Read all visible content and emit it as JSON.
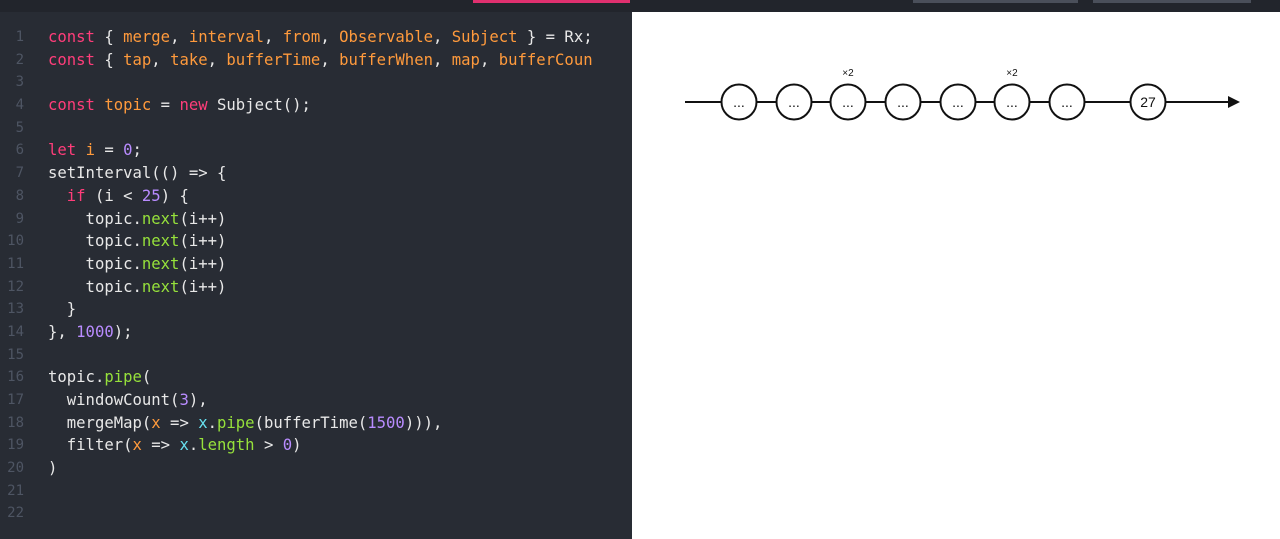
{
  "editor": {
    "line_numbers": [
      "1",
      "2",
      "3",
      "4",
      "5",
      "6",
      "7",
      "8",
      "9",
      "10",
      "11",
      "12",
      "13",
      "14",
      "15",
      "16",
      "17",
      "18",
      "19",
      "20",
      "21",
      "22"
    ],
    "lines": [
      [
        {
          "t": "const",
          "c": "kw"
        },
        {
          "t": " { ",
          "c": ""
        },
        {
          "t": "merge",
          "c": "id"
        },
        {
          "t": ", ",
          "c": ""
        },
        {
          "t": "interval",
          "c": "id"
        },
        {
          "t": ", ",
          "c": ""
        },
        {
          "t": "from",
          "c": "id"
        },
        {
          "t": ", ",
          "c": ""
        },
        {
          "t": "Observable",
          "c": "id"
        },
        {
          "t": ", ",
          "c": ""
        },
        {
          "t": "Subject",
          "c": "id"
        },
        {
          "t": " } = Rx;",
          "c": ""
        }
      ],
      [
        {
          "t": "const",
          "c": "kw"
        },
        {
          "t": " { ",
          "c": ""
        },
        {
          "t": "tap",
          "c": "id"
        },
        {
          "t": ", ",
          "c": ""
        },
        {
          "t": "take",
          "c": "id"
        },
        {
          "t": ", ",
          "c": ""
        },
        {
          "t": "bufferTime",
          "c": "id"
        },
        {
          "t": ", ",
          "c": ""
        },
        {
          "t": "bufferWhen",
          "c": "id"
        },
        {
          "t": ", ",
          "c": ""
        },
        {
          "t": "map",
          "c": "id"
        },
        {
          "t": ", ",
          "c": ""
        },
        {
          "t": "bufferCoun",
          "c": "id"
        }
      ],
      [],
      [
        {
          "t": "const",
          "c": "kw"
        },
        {
          "t": " ",
          "c": ""
        },
        {
          "t": "topic",
          "c": "id"
        },
        {
          "t": " = ",
          "c": ""
        },
        {
          "t": "new",
          "c": "kw"
        },
        {
          "t": " Subject();",
          "c": ""
        }
      ],
      [],
      [
        {
          "t": "let",
          "c": "kw"
        },
        {
          "t": " ",
          "c": ""
        },
        {
          "t": "i",
          "c": "id"
        },
        {
          "t": " = ",
          "c": ""
        },
        {
          "t": "0",
          "c": "num"
        },
        {
          "t": ";",
          "c": ""
        }
      ],
      [
        {
          "t": "setInterval(() => {",
          "c": ""
        }
      ],
      [
        {
          "t": "  ",
          "c": ""
        },
        {
          "t": "if",
          "c": "kw"
        },
        {
          "t": " (i < ",
          "c": ""
        },
        {
          "t": "25",
          "c": "num"
        },
        {
          "t": ") {",
          "c": ""
        }
      ],
      [
        {
          "t": "    topic.",
          "c": ""
        },
        {
          "t": "next",
          "c": "mth"
        },
        {
          "t": "(i++)",
          "c": ""
        }
      ],
      [
        {
          "t": "    topic.",
          "c": ""
        },
        {
          "t": "next",
          "c": "mth"
        },
        {
          "t": "(i++)",
          "c": ""
        }
      ],
      [
        {
          "t": "    topic.",
          "c": ""
        },
        {
          "t": "next",
          "c": "mth"
        },
        {
          "t": "(i++)",
          "c": ""
        }
      ],
      [
        {
          "t": "    topic.",
          "c": ""
        },
        {
          "t": "next",
          "c": "mth"
        },
        {
          "t": "(i++)",
          "c": ""
        }
      ],
      [
        {
          "t": "  }",
          "c": ""
        }
      ],
      [
        {
          "t": "}, ",
          "c": ""
        },
        {
          "t": "1000",
          "c": "num"
        },
        {
          "t": ");",
          "c": ""
        }
      ],
      [],
      [
        {
          "t": "topic.",
          "c": ""
        },
        {
          "t": "pipe",
          "c": "mth"
        },
        {
          "t": "(",
          "c": ""
        }
      ],
      [
        {
          "t": "  windowCount(",
          "c": ""
        },
        {
          "t": "3",
          "c": "num"
        },
        {
          "t": "),",
          "c": ""
        }
      ],
      [
        {
          "t": "  mergeMap(",
          "c": ""
        },
        {
          "t": "x",
          "c": "id"
        },
        {
          "t": " => ",
          "c": ""
        },
        {
          "t": "x",
          "c": "prm"
        },
        {
          "t": ".",
          "c": ""
        },
        {
          "t": "pipe",
          "c": "mth"
        },
        {
          "t": "(bufferTime(",
          "c": ""
        },
        {
          "t": "1500",
          "c": "num"
        },
        {
          "t": "))),",
          "c": ""
        }
      ],
      [
        {
          "t": "  filter(",
          "c": ""
        },
        {
          "t": "x",
          "c": "id"
        },
        {
          "t": " => ",
          "c": ""
        },
        {
          "t": "x",
          "c": "prm"
        },
        {
          "t": ".",
          "c": ""
        },
        {
          "t": "length",
          "c": "mth"
        },
        {
          "t": " > ",
          "c": ""
        },
        {
          "t": "0",
          "c": "num"
        },
        {
          "t": ")",
          "c": ""
        }
      ],
      [
        {
          "t": ")",
          "c": ""
        }
      ],
      [],
      []
    ]
  },
  "marble": {
    "marbles": [
      {
        "label": "...",
        "count": ""
      },
      {
        "label": "...",
        "count": ""
      },
      {
        "label": "...",
        "count": "×2"
      },
      {
        "label": "...",
        "count": ""
      },
      {
        "label": "...",
        "count": ""
      },
      {
        "label": "...",
        "count": "×2"
      },
      {
        "label": "...",
        "count": ""
      },
      {
        "label": "27",
        "count": ""
      }
    ]
  }
}
